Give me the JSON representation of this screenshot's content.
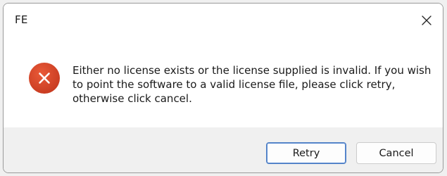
{
  "window": {
    "title": "FE",
    "close_icon": "close-icon"
  },
  "message": {
    "icon": "error-icon",
    "text": "Either no license exists or the license supplied is invalid. If you wish to point the software to a valid license file, please click retry, otherwise click cancel."
  },
  "buttons": {
    "retry_label": "Retry",
    "cancel_label": "Cancel"
  },
  "colors": {
    "error_icon": "#d9472b",
    "primary_button_border": "#4f7fc4",
    "footer_background": "#f0f0f0"
  }
}
